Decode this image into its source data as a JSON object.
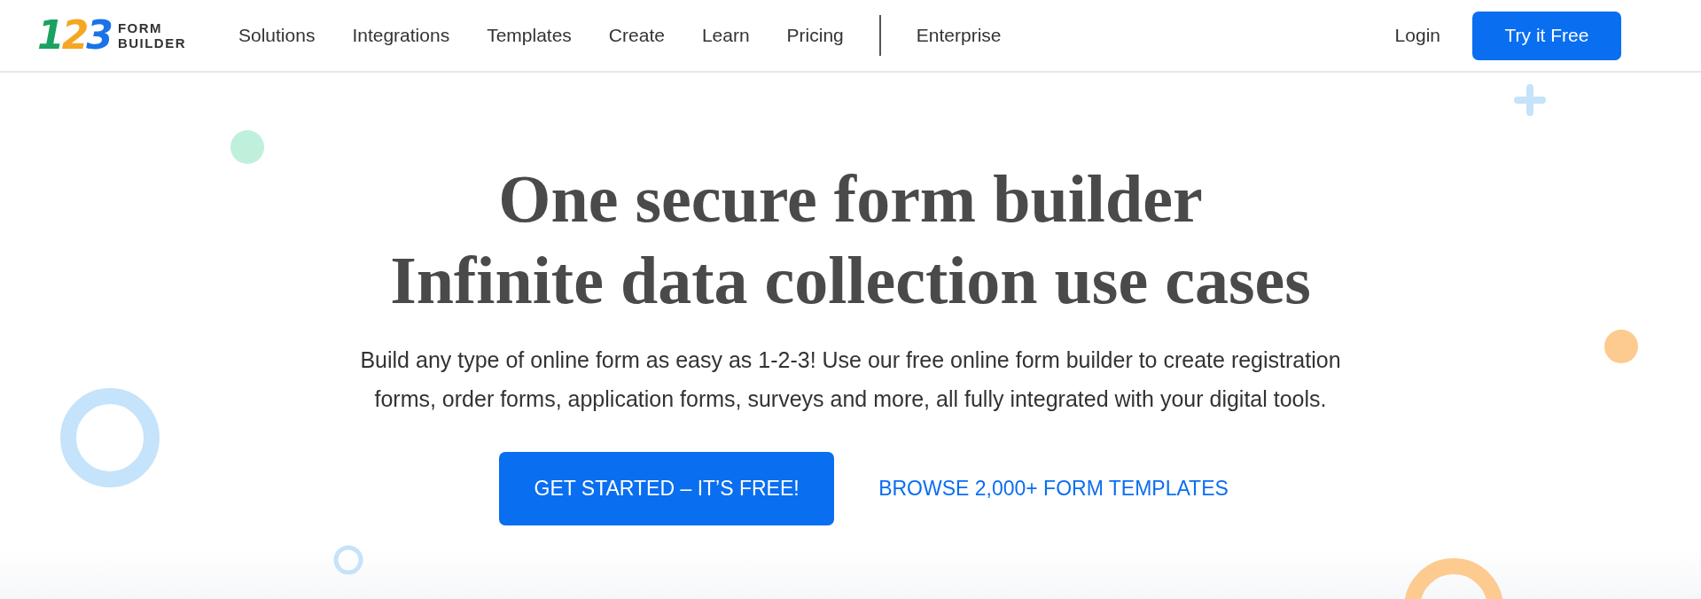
{
  "logo": {
    "digits": [
      {
        "text": "1",
        "color": "#1aa260"
      },
      {
        "text": "2",
        "color": "#f5a623"
      },
      {
        "text": "3",
        "color": "#1a73e8"
      }
    ],
    "wordmark": [
      "FORM",
      "BUILDER"
    ]
  },
  "nav": [
    "Solutions",
    "Integrations",
    "Templates",
    "Create",
    "Learn",
    "Pricing",
    "Enterprise"
  ],
  "login": "Login",
  "try_button": "Try it Free",
  "hero": {
    "headline": [
      "One secure form builder",
      "Infinite data collection use cases"
    ],
    "description": "Build any type of online form as easy as 1-2-3! Use our free online form builder to create registration forms, order forms, application forms, surveys and more, all fully integrated with your digital tools.",
    "primary_button": "GET STARTED – IT’S FREE!",
    "secondary_link": "BROWSE 2,000+ FORM TEMPLATES"
  }
}
